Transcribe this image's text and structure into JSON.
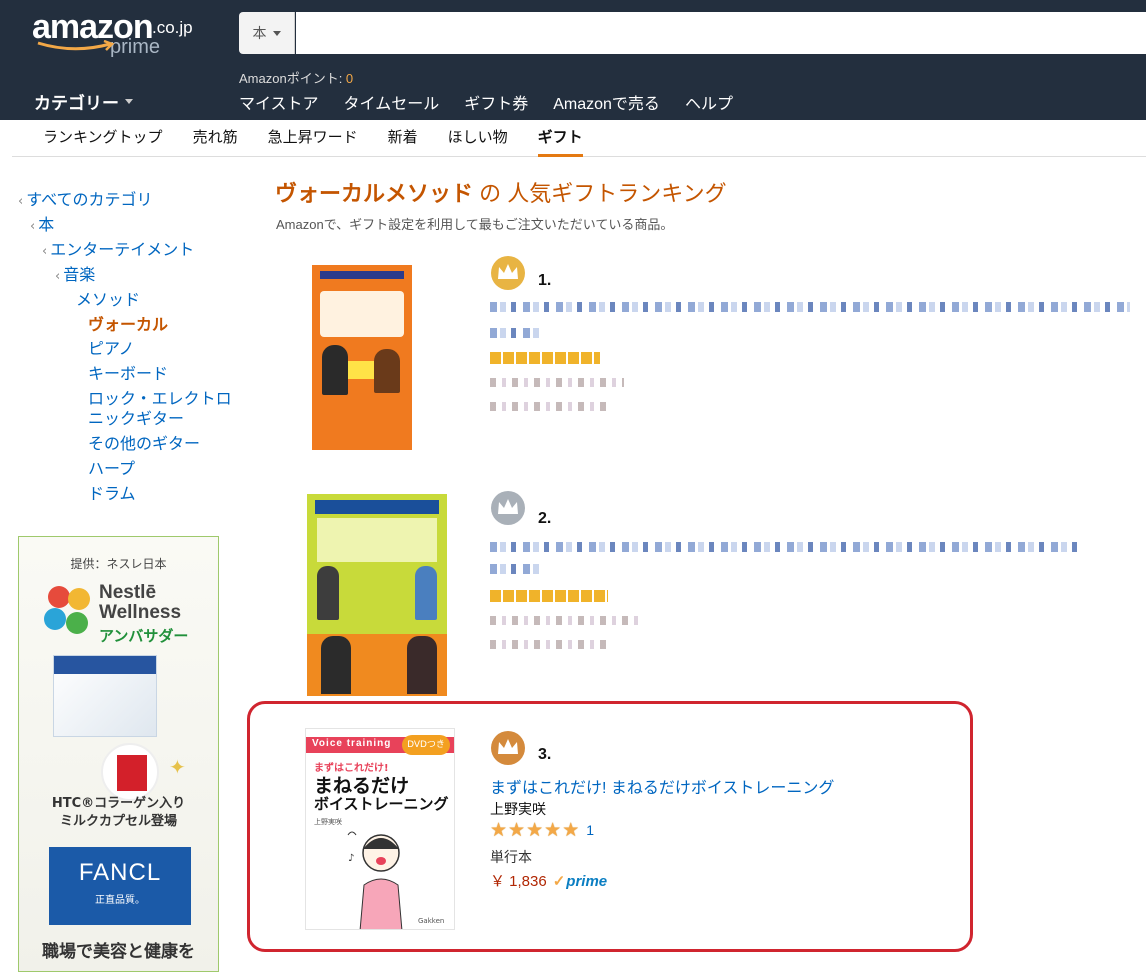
{
  "header": {
    "logo_text": "amazon",
    "logo_tld": ".co.jp",
    "logo_prime": "prime",
    "search_dept": "本",
    "search_placeholder": "",
    "points_label": "Amazonポイント: ",
    "points_value": "0",
    "category_label": "カテゴリー",
    "nav": [
      "マイストア",
      "タイムセール",
      "ギフト券",
      "Amazonで売る",
      "ヘルプ"
    ],
    "colors": {
      "bg": "#232f3e",
      "accent": "#f3a847"
    }
  },
  "subnav": {
    "tabs": [
      "ランキングトップ",
      "売れ筋",
      "急上昇ワード",
      "新着",
      "ほしい物",
      "ギフト"
    ],
    "active": "ギフト"
  },
  "sidebar": {
    "crumbs": [
      "すべてのカテゴリ",
      "本",
      "エンターテイメント",
      "音楽"
    ],
    "parent": "メソッド",
    "current": "ヴォーカル",
    "siblings": [
      "ピアノ",
      "キーボード",
      "ロック・エレクトロ",
      "ニックギター",
      "その他のギター",
      "ハープ",
      "ドラム"
    ]
  },
  "ad": {
    "sponsor": "提供：ネスレ日本",
    "brand_line1": "Nestlē",
    "brand_line2": "Wellness",
    "ambassador": "アンバサダー",
    "collagen_line1": "HTC®コラーゲン入り",
    "collagen_line2": "ミルクカプセル登場",
    "fancl": "FANCL",
    "fancl_sub": "正直品質。",
    "promo": "職場で美容と健康を"
  },
  "main": {
    "title_category": "ヴォーカルメソッド",
    "title_rest": " の 人気ギフトランキング",
    "subtitle": "Amazonで、ギフト設定を利用して最もご注文いただいている商品。",
    "items": [
      {
        "rank": "1.",
        "crown": "gold"
      },
      {
        "rank": "2.",
        "crown": "silver"
      },
      {
        "rank": "3.",
        "crown": "bronze",
        "title": "まずはこれだけ! まねるだけボイストレーニング",
        "author": "上野実咲",
        "rating": 5,
        "review_count": "1",
        "format": "単行本",
        "price": "￥ 1,836",
        "prime": "prime",
        "cover": {
          "top": "Voice training",
          "badge": "DVDつき",
          "kicker": "まずはこれだけ!",
          "title1": "まねるだけ",
          "title2": "ボイストレーニング",
          "author_small": "上野実咲",
          "publisher": "Gakken"
        }
      }
    ]
  }
}
